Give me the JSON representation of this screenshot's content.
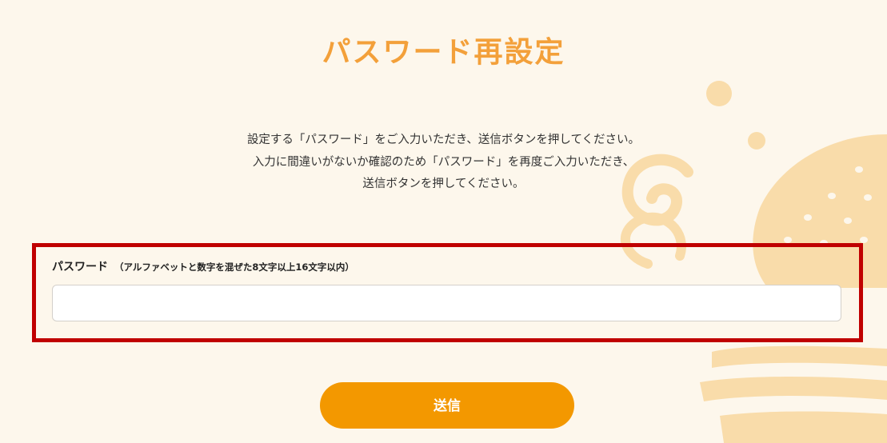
{
  "page": {
    "title": "パスワード再設定"
  },
  "instructions": {
    "line1": "設定する「パスワード」をご入力いただき、送信ボタンを押してください。",
    "line2": "入力に間違いがないか確認のため「パスワード」を再度ご入力いただき、",
    "line3": "送信ボタンを押してください。"
  },
  "password_field": {
    "label": "パスワード",
    "note": "（アルファベットと数字を混ぜた8文字以上16文字以内）",
    "value": "",
    "placeholder": ""
  },
  "submit": {
    "label": "送信"
  },
  "colors": {
    "background": "#fdf7ec",
    "title": "#f3a03a",
    "button": "#f39800",
    "highlight_border": "#c00000",
    "decoration": "#f9dcaa"
  }
}
